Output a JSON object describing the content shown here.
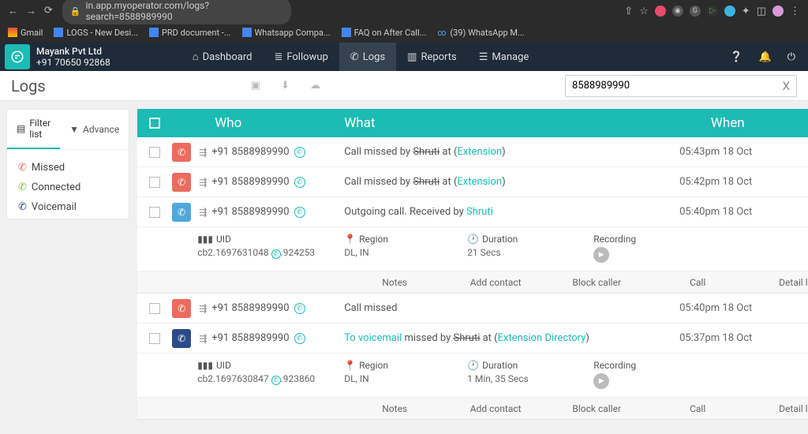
{
  "browser": {
    "url": "in.app.myoperator.com/logs?search=8588989990",
    "bookmarks": [
      "Gmail",
      "LOGS - New Desi...",
      "PRD document -...",
      "Whatsapp Compa...",
      "FAQ on After Call...",
      "(39) WhatsApp M..."
    ]
  },
  "header": {
    "org_name": "Mayank Pvt Ltd",
    "org_phone": "+91 70650 92868",
    "nav": [
      "Dashboard",
      "Followup",
      "Logs",
      "Reports",
      "Manage"
    ]
  },
  "page_title": "Logs",
  "search_value": "8588989990",
  "sidebar": {
    "tabs": [
      "Filter list",
      "Advance"
    ],
    "filters": [
      "Missed",
      "Connected",
      "Voicemail"
    ]
  },
  "columns": {
    "who": "Who",
    "what": "What",
    "when": "When"
  },
  "rows": [
    {
      "color": "red",
      "number": "+91 8588989990",
      "what_pre": "Call missed by ",
      "strike": "Shruti",
      "what_mid": " at (",
      "link": "Extension",
      "what_post": ")",
      "when": "05:43pm 18 Oct"
    },
    {
      "color": "red",
      "number": "+91 8588989990",
      "what_pre": "Call missed by ",
      "strike": "Shruti",
      "what_mid": " at (",
      "link": "Extension",
      "what_post": ")",
      "when": "05:42pm 18 Oct"
    },
    {
      "color": "bluel",
      "number": "+91 8588989990",
      "what_pre": "Outgoing call. Received by ",
      "strike": "",
      "what_mid": "",
      "link": "Shruti",
      "what_post": "",
      "when": "05:40pm 18 Oct"
    },
    {
      "color": "red",
      "number": "+91 8588989990",
      "what_pre": "Call missed",
      "strike": "",
      "what_mid": "",
      "link": "",
      "what_post": "",
      "when": "05:40pm 18 Oct"
    },
    {
      "color": "blued",
      "number": "+91 8588989990",
      "what_pre": "",
      "pre_link": "To voicemail",
      "what_pre2": " missed by ",
      "strike": "Shruti",
      "what_mid": " at (",
      "link": "Extension Directory",
      "what_post": ")",
      "when": "05:37pm 18 Oct"
    }
  ],
  "details": [
    {
      "uid_lbl": "UID",
      "uid": "cb2.1697631048",
      "ext": ".924253",
      "region_lbl": "Region",
      "region": "DL, IN",
      "dur_lbl": "Duration",
      "dur": "21 Secs",
      "rec_lbl": "Recording"
    },
    {
      "uid_lbl": "UID",
      "uid": "cb2.1697630847",
      "ext": ".923860",
      "region_lbl": "Region",
      "region": "DL, IN",
      "dur_lbl": "Duration",
      "dur": "1 Min, 35 Secs",
      "rec_lbl": "Recording"
    }
  ],
  "actions": [
    "Notes",
    "Add contact",
    "Block caller",
    "Call",
    "Detail log"
  ]
}
